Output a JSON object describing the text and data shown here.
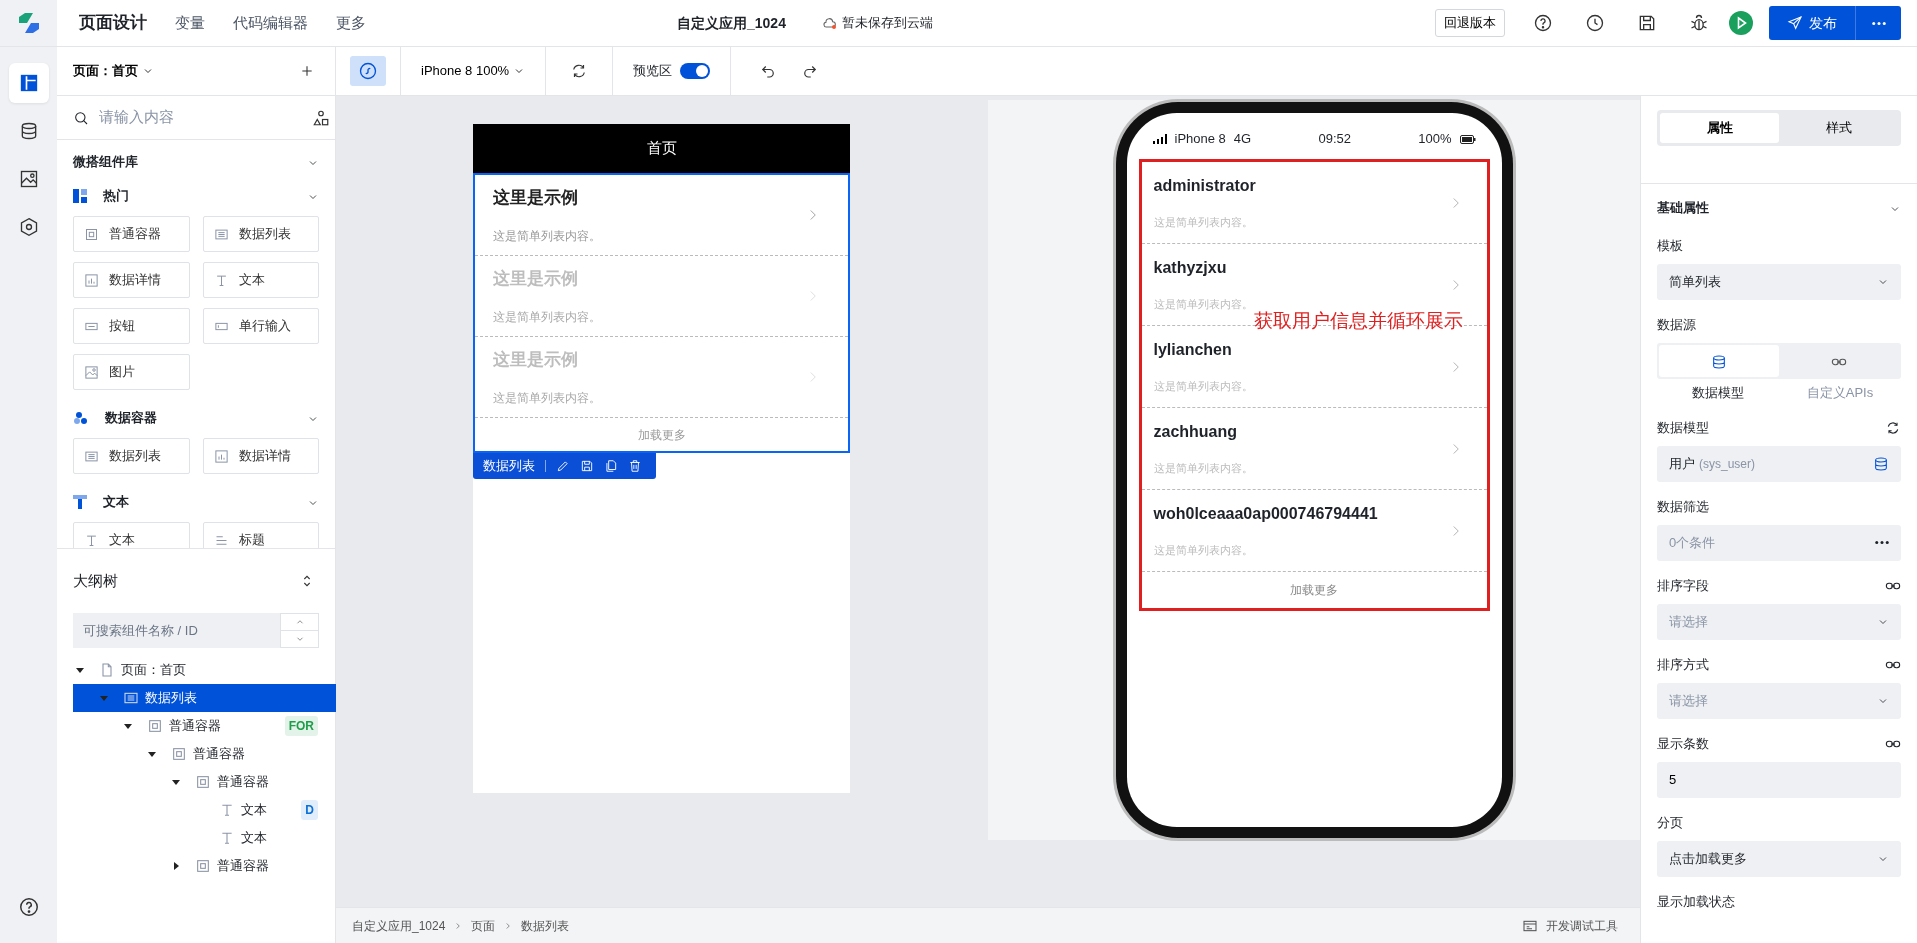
{
  "topbar": {
    "nav": [
      {
        "label": "页面设计",
        "selected": true
      },
      {
        "label": "变量",
        "selected": false
      },
      {
        "label": "代码编辑器",
        "selected": false
      },
      {
        "label": "更多",
        "selected": false
      }
    ],
    "app_title": "自定义应用_1024",
    "save_status": "暂未保存到云端",
    "rollback_button": "回退版本",
    "publish_button": "发布"
  },
  "rail": [
    {
      "kind": "layout",
      "selected": true
    },
    {
      "kind": "database",
      "selected": false
    },
    {
      "kind": "image",
      "selected": false
    },
    {
      "kind": "hexagon",
      "selected": false
    }
  ],
  "left_panel": {
    "page_selector": "页面：首页",
    "search": {
      "placeholder": "请输入内容"
    },
    "library_title": "微搭组件库",
    "groups": [
      {
        "title": "热门",
        "kind": "hot",
        "expanded": true,
        "items": [
          {
            "label": "普通容器",
            "kind": "container"
          },
          {
            "label": "数据列表",
            "kind": "list"
          },
          {
            "label": "数据详情",
            "kind": "detail"
          },
          {
            "label": "文本",
            "kind": "text"
          },
          {
            "label": "按钮",
            "kind": "button"
          },
          {
            "label": "单行输入",
            "kind": "input"
          },
          {
            "label": "图片",
            "kind": "image"
          }
        ]
      },
      {
        "title": "数据容器",
        "kind": "data",
        "expanded": true,
        "items": [
          {
            "label": "数据列表",
            "kind": "list"
          },
          {
            "label": "数据详情",
            "kind": "detail"
          }
        ]
      },
      {
        "title": "文本",
        "kind": "text",
        "expanded": true,
        "items": [
          {
            "label": "文本",
            "kind": "text"
          },
          {
            "label": "标题",
            "kind": "heading"
          }
        ]
      }
    ]
  },
  "outline": {
    "title": "大纲树",
    "search": {
      "placeholder": "可搜索组件名称 / ID"
    },
    "tree": [
      {
        "label": "页面：首页",
        "kind": "page",
        "expanded": true,
        "selected": false,
        "children": [
          {
            "label": "数据列表",
            "kind": "list",
            "expanded": true,
            "selected": true,
            "children": [
              {
                "label": "普通容器",
                "kind": "container",
                "expanded": true,
                "selected": false,
                "badge": {
                  "text": "FOR",
                  "color": "#1e9e4a"
                },
                "children": [
                  {
                    "label": "普通容器",
                    "kind": "container",
                    "expanded": true,
                    "selected": false,
                    "children": [
                      {
                        "label": "普通容器",
                        "kind": "container",
                        "expanded": true,
                        "selected": false,
                        "children": [
                          {
                            "label": "文本",
                            "kind": "text",
                            "selected": false,
                            "badge": {
                              "text": "D",
                              "color": "#0a6fd6"
                            }
                          },
                          {
                            "label": "文本",
                            "kind": "text",
                            "selected": false
                          }
                        ]
                      },
                      {
                        "label": "普通容器",
                        "kind": "container",
                        "expanded": false,
                        "selected": false
                      }
                    ]
                  }
                ]
              }
            ]
          }
        ]
      }
    ]
  },
  "toolbar": {
    "device": "iPhone 8 100%",
    "preview": {
      "label": "预览区",
      "on": true
    }
  },
  "editor_canvas": {
    "header": "首页",
    "items": [
      {
        "title": "这里是示例",
        "desc": "这是简单列表内容。",
        "faded": false
      },
      {
        "title": "这里是示例",
        "desc": "这是简单列表内容。",
        "faded": true
      },
      {
        "title": "这里是示例",
        "desc": "这是简单列表内容。",
        "faded": true
      }
    ],
    "load_more": "加载更多",
    "selection_label": "数据列表"
  },
  "preview_phone": {
    "status": {
      "carrier": "iPhone 8",
      "network": "4G",
      "time": "09:52",
      "battery": "100%"
    },
    "rows": [
      {
        "title": "administrator",
        "desc": "这是简单列表内容。"
      },
      {
        "title": "kathyzjxu",
        "desc": "这是简单列表内容。"
      },
      {
        "title": "lylianchen",
        "desc": "这是简单列表内容。"
      },
      {
        "title": "zachhuang",
        "desc": "这是简单列表内容。"
      },
      {
        "title": "woh0lceaaa0ap000746794441",
        "desc": "这是简单列表内容。"
      }
    ],
    "load_more": "加载更多",
    "annotation": "获取用户信息并循环展示"
  },
  "right_panel": {
    "tabs": [
      {
        "label": "属性",
        "selected": true
      },
      {
        "label": "样式",
        "selected": false
      }
    ],
    "section": "基础属性",
    "fields": [
      {
        "label": "模板",
        "kind": "select",
        "value": "简单列表"
      },
      {
        "label": "数据源",
        "kind": "segmented",
        "options": [
          {
            "label": "数据模型",
            "selected": true
          },
          {
            "label": "自定义APIs",
            "selected": false
          }
        ]
      },
      {
        "label": "数据模型",
        "kind": "model",
        "value": "用户",
        "hint": "(sys_user)"
      },
      {
        "label": "数据筛选",
        "kind": "filter",
        "placeholder": "0个条件"
      },
      {
        "label": "排序字段",
        "kind": "select",
        "placeholder": "请选择",
        "bindable": true
      },
      {
        "label": "排序方式",
        "kind": "select",
        "placeholder": "请选择",
        "bindable": true
      },
      {
        "label": "显示条数",
        "kind": "input",
        "value": "5",
        "bindable": true
      },
      {
        "label": "分页",
        "kind": "select",
        "value": "点击加载更多"
      },
      {
        "label": "显示加载状态",
        "kind": "label"
      }
    ]
  },
  "footer": {
    "breadcrumb": [
      "自定义应用_1024",
      "页面",
      "数据列表"
    ],
    "devtools": "开发调试工具"
  }
}
